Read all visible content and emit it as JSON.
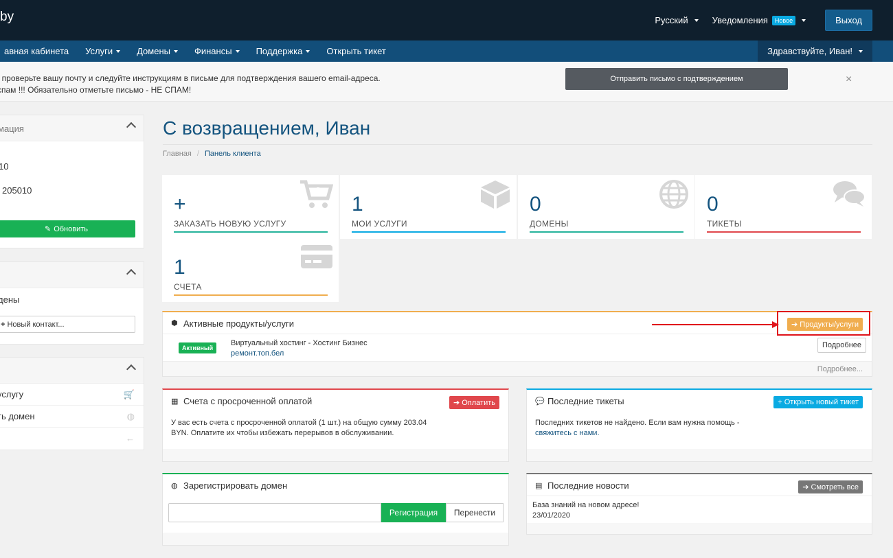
{
  "header": {
    "logo": "by",
    "language": "Русский",
    "notifications": "Уведомления",
    "notifications_badge": "Новое",
    "logout": "Выход"
  },
  "nav": {
    "items": [
      "авная кабинета",
      "Услуги",
      "Домены",
      "Финансы",
      "Поддержка",
      "Открыть тикет"
    ],
    "greeting": "Здравствуйте, Иван!"
  },
  "alert": {
    "line1": ", проверьте вашу почту и следуйте инструкциям в письме для подтверждения вашего email-адреса.",
    "line2": "спам !!! Обязательно отметьте письмо - НЕ СПАМ!",
    "button": "Отправить письмо с подтверждением",
    "close": "×"
  },
  "sidebar": {
    "info_title": "мация",
    "info_line1": "10",
    "info_line2": "205010",
    "update_button": "Обновить",
    "contacts_row": "дены",
    "new_contact_button": "Новый контакт...",
    "shortcut1": "услугу",
    "shortcut2": "ть домен"
  },
  "main": {
    "title": "С возвращением, Иван",
    "breadcrumb_home": "Главная",
    "breadcrumb_sep": "/",
    "breadcrumb_current": "Панель клиента"
  },
  "tiles": [
    {
      "num": "+",
      "label": "ЗАКАЗАТЬ НОВУЮ УСЛУГУ",
      "color": "#25b39b",
      "icon": "cart-icon"
    },
    {
      "num": "1",
      "label": "МОИ УСЛУГИ",
      "color": "#0aaae2",
      "icon": "cube-icon"
    },
    {
      "num": "0",
      "label": "ДОМЕНЫ",
      "color": "#25b39b",
      "icon": "globe-icon"
    },
    {
      "num": "0",
      "label": "ТИКЕТЫ",
      "color": "#e0474c",
      "icon": "comments-icon"
    },
    {
      "num": "1",
      "label": "СЧЕТА",
      "color": "#f0ad4e",
      "icon": "credit-card-icon"
    }
  ],
  "active_products": {
    "title": "Активные продукты/услуги",
    "button": "Продукты/услуги",
    "status": "Активный",
    "product_name": "Виртуальный хостинг - Хостинг Бизнес",
    "product_domain": "ремонт.топ.бел",
    "details_button": "Подробнее",
    "more_link": "Подробнее..."
  },
  "overdue": {
    "title": "Счета с просроченной оплатой",
    "button": "Оплатить",
    "line1": "У вас есть счета с просроченной оплатой (1 шт.) на общую сумму 203.04",
    "line2": "BYN. Оплатите их чтобы избежать перерывов в обслуживании."
  },
  "tickets": {
    "title": "Последние тикеты",
    "button": "Открыть новый тикет",
    "line1": "Последних тикетов не найдено. Если вам нужна помощь -",
    "link": "свяжитесь с нами."
  },
  "domain_register": {
    "title": "Зарегистрировать домен",
    "register_button": "Регистрация",
    "transfer_button": "Перенести"
  },
  "news": {
    "title": "Последние новости",
    "button": "Смотреть все",
    "item_title": "База знаний на новом адресе!",
    "item_date": "23/01/2020"
  },
  "colors": {
    "header": "#0f1f2d",
    "nav": "#124e7a",
    "accent_green": "#19b155",
    "accent_orange": "#f0ad4e",
    "accent_red": "#e0474c",
    "accent_cyan": "#0aaae2",
    "annotation": "#e0141b"
  }
}
